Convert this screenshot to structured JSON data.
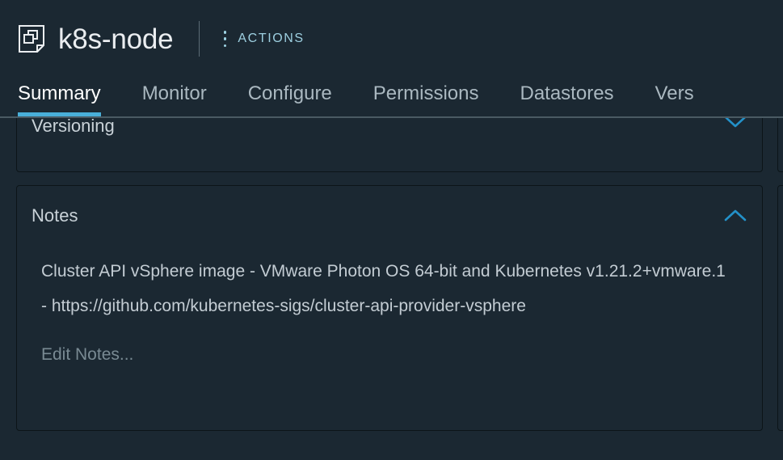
{
  "header": {
    "object_icon": "vm-template-icon",
    "title": "k8s-node",
    "actions_label": "ACTIONS",
    "kebab_icon": "kebab-menu-icon"
  },
  "tabs": [
    {
      "label": "Summary",
      "active": true
    },
    {
      "label": "Monitor",
      "active": false
    },
    {
      "label": "Configure",
      "active": false
    },
    {
      "label": "Permissions",
      "active": false
    },
    {
      "label": "Datastores",
      "active": false
    },
    {
      "label": "Vers",
      "active": false
    }
  ],
  "panels": {
    "versioning": {
      "title": "Versioning",
      "expanded": false,
      "chevron_icon": "chevron-down-icon"
    },
    "notes": {
      "title": "Notes",
      "expanded": true,
      "chevron_icon": "chevron-up-icon",
      "body": "Cluster API vSphere image - VMware Photon OS 64-bit and Kubernetes v1.21.2+vmware.1 - https://github.com/kubernetes-sigs/cluster-api-provider-vsphere",
      "edit_link": "Edit Notes..."
    }
  },
  "colors": {
    "background": "#1b2832",
    "panel_border": "#0c1418",
    "accent_blue": "#49afd9",
    "actions_blue": "#9dcfe0",
    "text_primary": "#eaedf0",
    "text_secondary": "#c3ccd3",
    "text_muted": "#798a93",
    "tab_inactive": "#aab8c0",
    "rule": "#4a5a63"
  }
}
